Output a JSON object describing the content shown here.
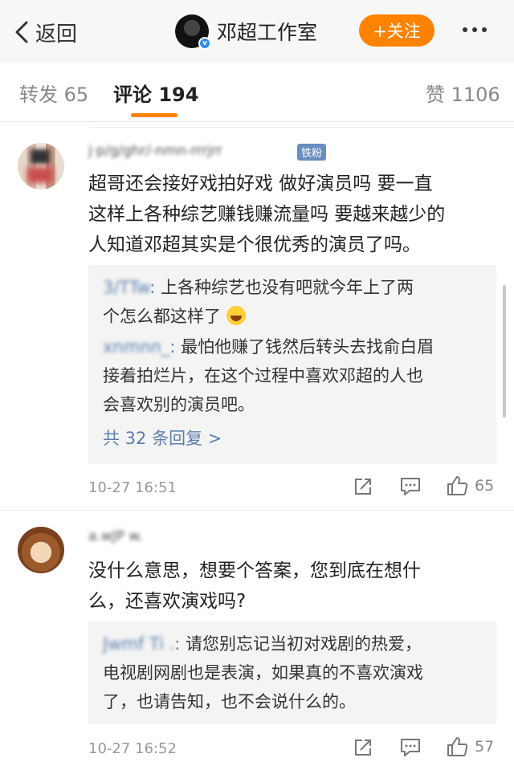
{
  "nav": {
    "back_label": "返回",
    "title": "邓超工作室",
    "follow_label": "+关注"
  },
  "tabs": [
    {
      "label": "转发 65"
    },
    {
      "label": "评论 194"
    },
    {
      "label": "赞 1106"
    }
  ],
  "comments": [
    {
      "user": "j·p/g/ghr/-nmn-rrrjrr",
      "badge": "铁粉",
      "text_lines": [
        "超哥还会接好戏拍好戏 做好演员吗 要一直",
        "这样上各种综艺赚钱赚流量吗 要越来越少的",
        "人知道邓超其实是个很优秀的演员了吗。"
      ],
      "replies": [
        {
          "user": "3/TTw",
          "lines": [
            "上各种综艺也没有吧就今年上了两",
            "个怎么都这样了"
          ]
        },
        {
          "user": "xnmnn_",
          "lines": [
            "最怕他赚了钱然后转头去找俞白眉",
            "接着拍烂片，在这个过程中喜欢邓超的人也",
            "会喜欢别的演员吧。"
          ]
        }
      ],
      "more_replies": "共 32 条回复 >",
      "time": "10-27 16:51",
      "likes": "65"
    },
    {
      "user": "a.wJP w.",
      "text_lines": [
        "没什么意思，想要个答案，您到底在想什",
        "么，还喜欢演戏吗?"
      ],
      "replies": [
        {
          "user": "Jwmf Ti .",
          "lines": [
            "请您别忘记当初对戏剧的热爱，",
            "电视剧网剧也是表演，如果真的不喜欢演戏",
            "了，也请告知，也不会说什么的。"
          ]
        }
      ],
      "time": "10-27 16:52",
      "likes": "57"
    }
  ],
  "colors": {
    "accent": "#ff8200",
    "link": "#5b7fb0",
    "verified": "#2c8cf0"
  },
  "icons": [
    "chevron-left-icon",
    "verified-icon",
    "more-dots-icon",
    "share-icon",
    "comment-icon",
    "like-icon",
    "laugh-cry-emoji-icon"
  ]
}
